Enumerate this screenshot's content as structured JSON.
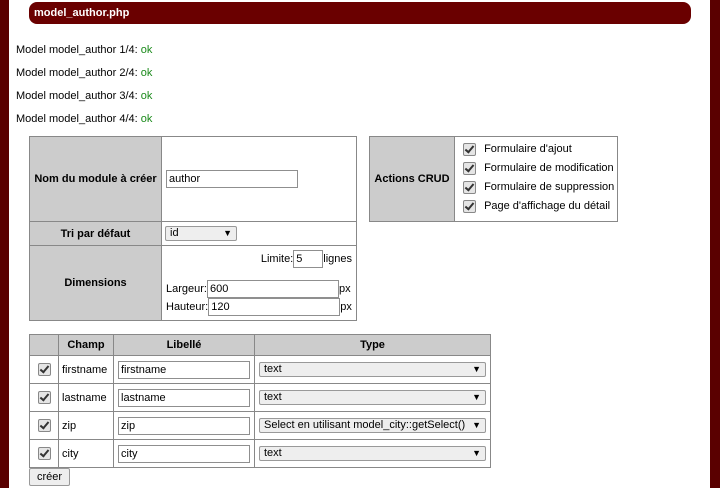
{
  "header": {
    "title": "model_author.php"
  },
  "log": [
    {
      "text": "Model model_author 1/4: ",
      "status": "ok"
    },
    {
      "text": "Model model_author 2/4: ",
      "status": "ok"
    },
    {
      "text": "Model model_author 3/4: ",
      "status": "ok"
    },
    {
      "text": "Model model_author 4/4: ",
      "status": "ok"
    }
  ],
  "module_form": {
    "name_label": "Nom du module à créer",
    "name_value": "author",
    "sort_label": "Tri par défaut",
    "sort_value": "id",
    "dimensions_label": "Dimensions",
    "limit_label": "Limite:",
    "limit_value": "5",
    "limit_unit": "lignes",
    "width_label": "Largeur:",
    "width_value": "600",
    "height_label": "Hauteur:",
    "height_value": "120",
    "px_unit": "px"
  },
  "crud": {
    "label": "Actions CRUD",
    "options": [
      {
        "label": "Formulaire d'ajout",
        "checked": true
      },
      {
        "label": "Formulaire de modification",
        "checked": true
      },
      {
        "label": "Formulaire de suppression",
        "checked": true
      },
      {
        "label": "Page d'affichage du détail",
        "checked": true
      }
    ]
  },
  "fields_table": {
    "headers": [
      "",
      "Champ",
      "Libellé",
      "Type"
    ],
    "rows": [
      {
        "checked": true,
        "champ": "firstname",
        "libelle": "firstname",
        "type": "text"
      },
      {
        "checked": true,
        "champ": "lastname",
        "libelle": "lastname",
        "type": "text"
      },
      {
        "checked": true,
        "champ": "zip",
        "libelle": "zip",
        "type": "Select en utilisant model_city::getSelect()"
      },
      {
        "checked": true,
        "champ": "city",
        "libelle": "city",
        "type": "text"
      }
    ]
  },
  "submit_label": "créer"
}
